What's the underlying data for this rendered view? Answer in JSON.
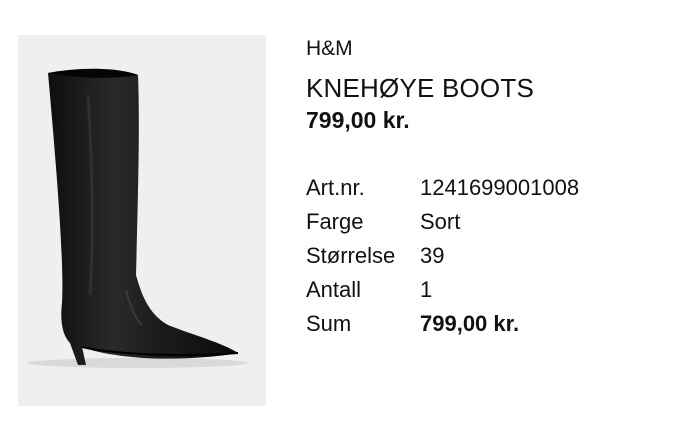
{
  "product": {
    "image_alt_name": "boot-product-image",
    "brand": "H&M",
    "title": "KNEHØYE BOOTS",
    "price": "799,00 kr."
  },
  "details": {
    "article_label": "Art.nr.",
    "article_value": "1241699001008",
    "color_label": "Farge",
    "color_value": "Sort",
    "size_label": "Størrelse",
    "size_value": "39",
    "quantity_label": "Antall",
    "quantity_value": "1",
    "sum_label": "Sum",
    "sum_value": "799,00 kr."
  },
  "colors": {
    "image_background": "#efefef",
    "boot": "#1a1a1a",
    "text": "#111111"
  }
}
